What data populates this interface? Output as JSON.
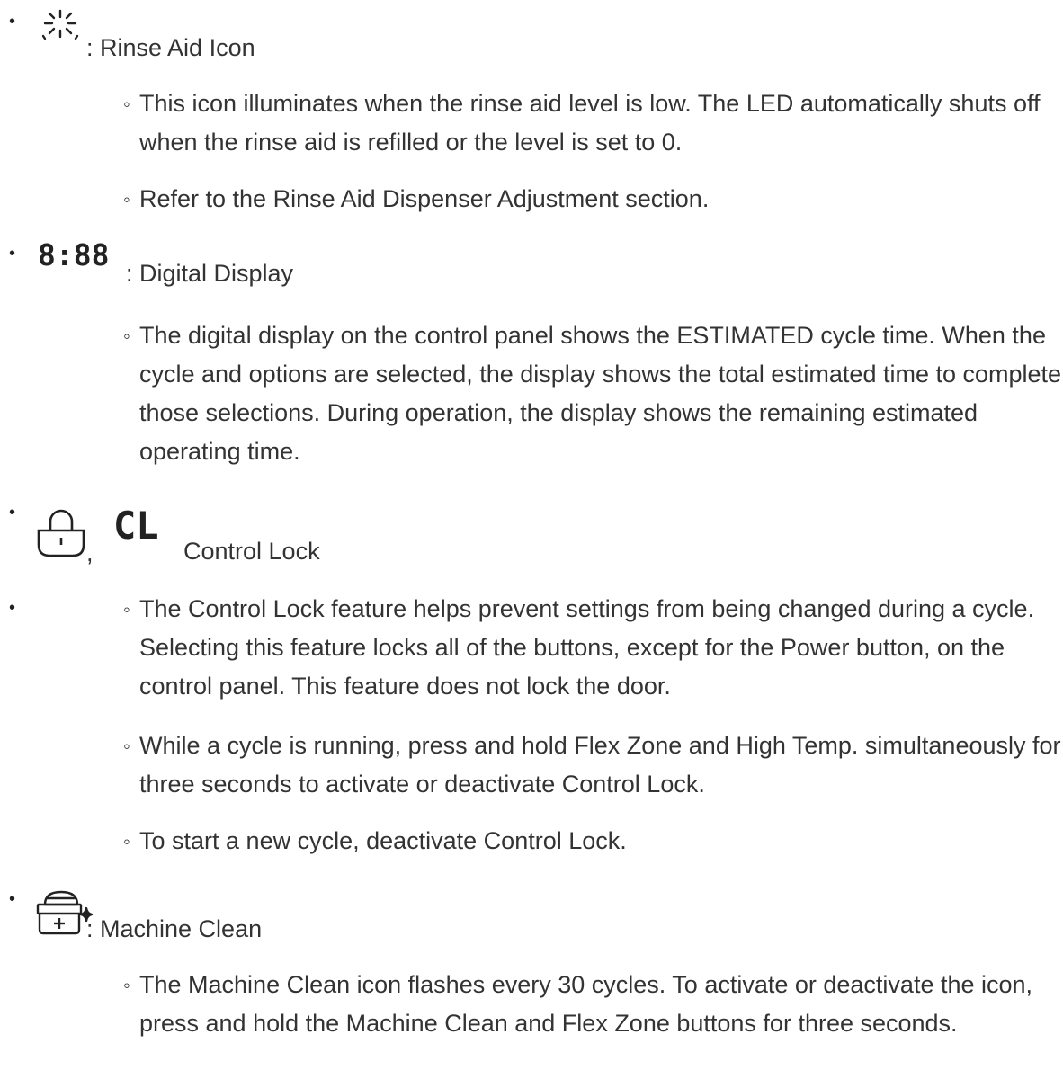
{
  "sections": [
    {
      "label": ": Rinse Aid Icon",
      "icon": "rinse-aid-sparkle-icon",
      "items": [
        "This icon illuminates when the rinse aid level is low. The LED automatically shuts off when the rinse aid is refilled or the level is set to 0.",
        "Refer to the Rinse Aid Dispenser Adjustment section."
      ]
    },
    {
      "label": ": Digital Display",
      "icon_text": "8:88",
      "items": [
        "The digital display on the control panel shows the ESTIMATED cycle time. When the cycle and options are selected, the display shows the total estimated time to complete those selections. During operation, the display shows the remaining estimated operating time."
      ]
    },
    {
      "label": "Control Lock",
      "separator": ",",
      "icon": "padlock-icon",
      "icon_text": "CL",
      "items": [
        "The Control Lock feature helps prevent settings from being changed during a cycle. Selecting this feature locks all of the buttons, except for the Power button, on the control panel. This feature does not lock the door.",
        "While a cycle is running, press and hold Flex Zone and High Temp. simultaneously for three seconds to activate or deactivate Control Lock.",
        "To start a new cycle, deactivate Control Lock."
      ]
    },
    {
      "label": ": Machine Clean",
      "icon": "machine-clean-icon",
      "items": [
        "The Machine Clean icon flashes every 30 cycles. To activate or deactivate the icon, press and hold the Machine Clean and Flex Zone buttons for three seconds."
      ]
    }
  ],
  "bullets": {
    "main": "•",
    "sub": "◦"
  }
}
